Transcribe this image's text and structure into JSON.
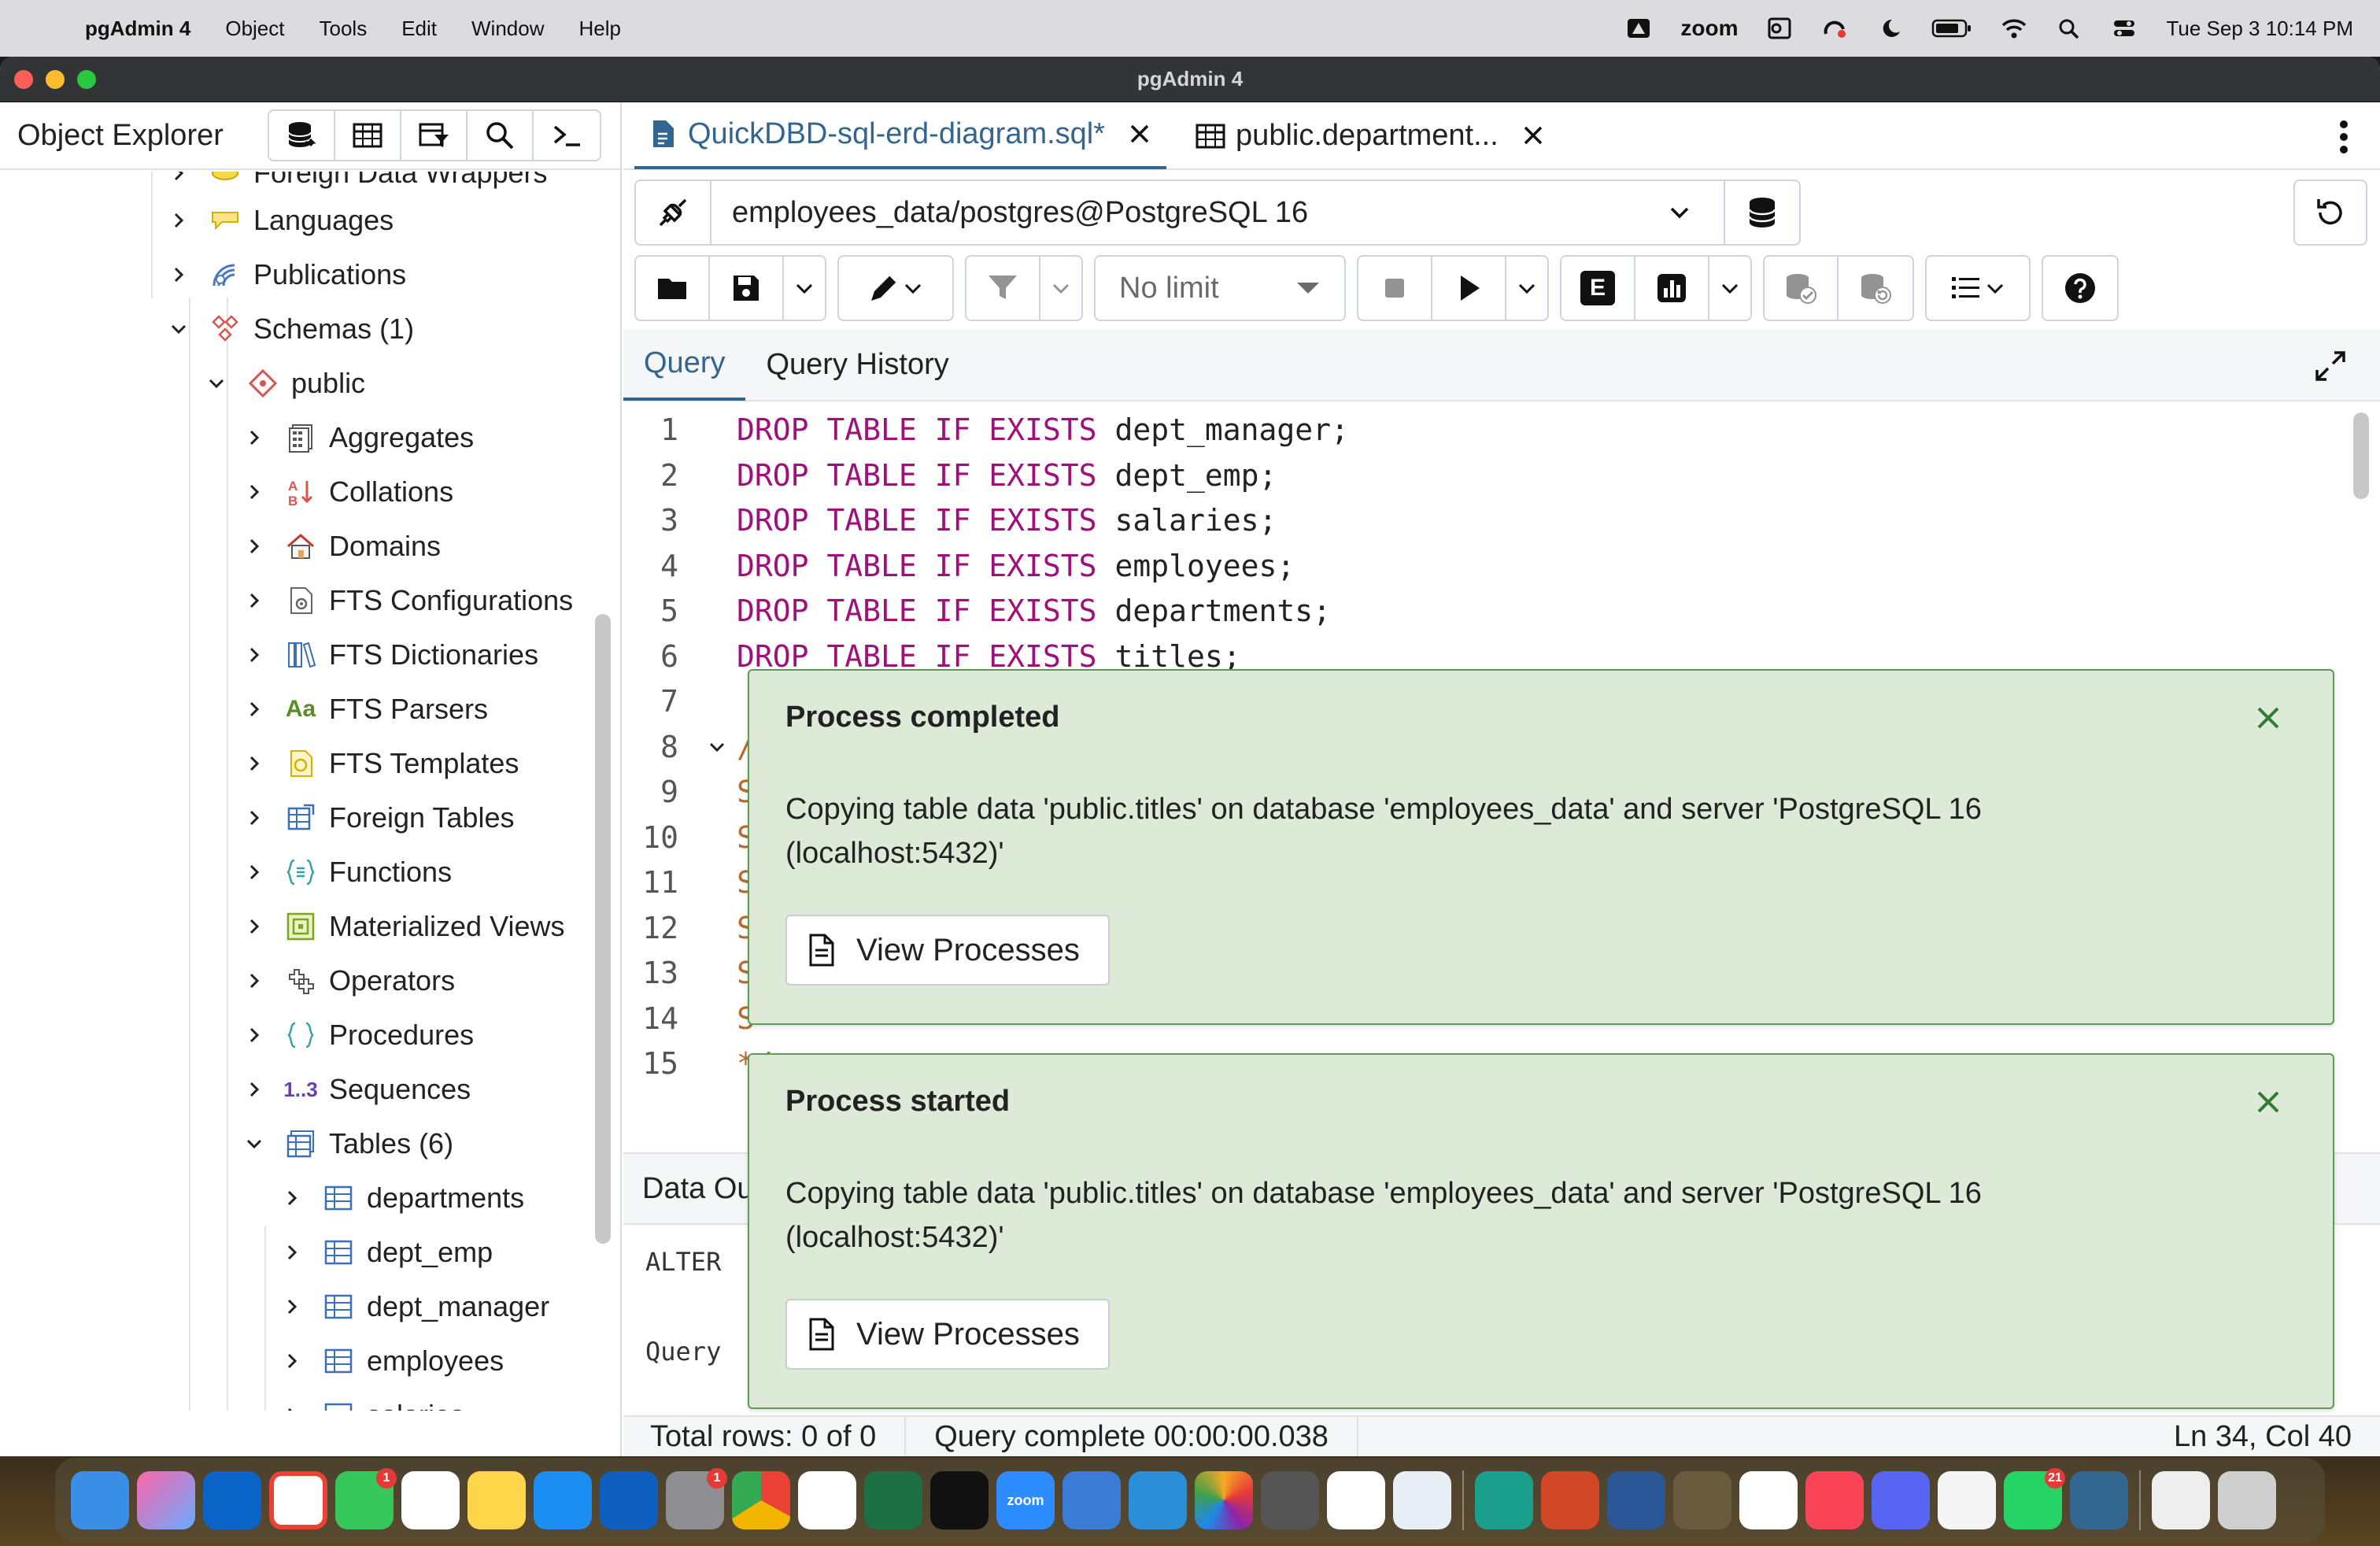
{
  "menubar": {
    "app_name": "pgAdmin 4",
    "menus": [
      "Object",
      "Tools",
      "Edit",
      "Window",
      "Help"
    ],
    "zoom_label": "zoom",
    "datetime": "Tue Sep 3  10:14 PM"
  },
  "window": {
    "title": "pgAdmin 4"
  },
  "object_explorer": {
    "title": "Object Explorer",
    "tree": {
      "partial_top": "Foreign Data Wrappers",
      "languages": "Languages",
      "publications": "Publications",
      "schemas": "Schemas (1)",
      "public": "public",
      "aggregates": "Aggregates",
      "collations": "Collations",
      "domains": "Domains",
      "fts_configurations": "FTS Configurations",
      "fts_dictionaries": "FTS Dictionaries",
      "fts_parsers": "FTS Parsers",
      "fts_templates": "FTS Templates",
      "foreign_tables": "Foreign Tables",
      "functions": "Functions",
      "materialized_views": "Materialized Views",
      "operators": "Operators",
      "procedures": "Procedures",
      "sequences": "Sequences",
      "tables": "Tables (6)",
      "departments": "departments",
      "dept_emp": "dept_emp",
      "dept_manager": "dept_manager",
      "employees": "employees",
      "salaries": "salaries"
    },
    "icon_labels": {
      "fts_parsers": "Aa",
      "sequences": "1..3"
    }
  },
  "tabs": [
    {
      "label": "QuickDBD-sql-erd-diagram.sql*"
    },
    {
      "label": "public.department..."
    }
  ],
  "connection": {
    "name": "employees_data/postgres@PostgreSQL 16"
  },
  "toolbar": {
    "limit": "No limit",
    "explain_label": "E"
  },
  "query_tabs": {
    "query": "Query",
    "history": "Query History"
  },
  "editor": {
    "lines": [
      {
        "n": "1",
        "kw": "DROP TABLE IF EXISTS",
        "rest": " dept_manager;"
      },
      {
        "n": "2",
        "kw": "DROP TABLE IF EXISTS",
        "rest": " dept_emp;"
      },
      {
        "n": "3",
        "kw": "DROP TABLE IF EXISTS",
        "rest": " salaries;"
      },
      {
        "n": "4",
        "kw": "DROP TABLE IF EXISTS",
        "rest": " employees;"
      },
      {
        "n": "5",
        "kw": "DROP TABLE IF EXISTS",
        "rest": " departments;"
      },
      {
        "n": "6",
        "kw": "DROP TABLE IF EXISTS",
        "rest": " titles;"
      },
      {
        "n": "7",
        "kw": "",
        "rest": ""
      },
      {
        "n": "8",
        "kw": "",
        "rest": "/"
      },
      {
        "n": "9",
        "kw": "",
        "rest": "S"
      },
      {
        "n": "10",
        "kw": "",
        "rest": "S"
      },
      {
        "n": "11",
        "kw": "",
        "rest": "S"
      },
      {
        "n": "12",
        "kw": "",
        "rest": "S"
      },
      {
        "n": "13",
        "kw": "",
        "rest": "S"
      },
      {
        "n": "14",
        "kw": "",
        "rest": "S"
      },
      {
        "n": "15",
        "kw": "",
        "rest": "*/"
      }
    ]
  },
  "results": {
    "tab_label": "Data Ou",
    "line1": "ALTER ",
    "line2": "Query "
  },
  "status": {
    "rows": "Total rows: 0 of 0",
    "query": "Query complete 00:00:00.038",
    "position": "Ln 34, Col 40"
  },
  "notifications": [
    {
      "title": "Process completed",
      "message": "Copying table data 'public.titles' on database 'employees_data' and server 'PostgreSQL 16 (localhost:5432)'",
      "button": "View Processes"
    },
    {
      "title": "Process started",
      "message": "Copying table data 'public.titles' on database 'employees_data' and server 'PostgreSQL 16 (localhost:5432)'",
      "button": "View Processes"
    }
  ],
  "dock": {
    "zoom_label": "zoom",
    "badges": {
      "facetime": "1",
      "settings": "1",
      "whatsapp": "21"
    },
    "colors": {
      "finder": "#3a8ee6",
      "gmail": "#ea4335",
      "chrome": "#f2b600",
      "excel": "#1d7044",
      "vscode": "#2a8fd8",
      "word": "#2b5797",
      "powerpoint": "#d24726",
      "music": "#f94458",
      "discord": "#5865f2",
      "whatsapp": "#25d366"
    }
  }
}
